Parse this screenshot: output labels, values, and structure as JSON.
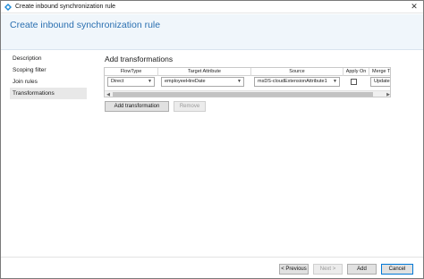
{
  "window": {
    "title": "Create inbound synchronization rule",
    "close_label": "✕"
  },
  "header": {
    "title": "Create inbound synchronization rule"
  },
  "nav": {
    "items": [
      {
        "label": "Description"
      },
      {
        "label": "Scoping filter"
      },
      {
        "label": "Join rules"
      },
      {
        "label": "Transformations"
      }
    ],
    "active": "Transformations"
  },
  "section": {
    "title": "Add transformations"
  },
  "grid": {
    "columns": [
      "FlowType",
      "Target Attribute",
      "Source",
      "Apply On",
      "Merge Type"
    ],
    "rows": [
      {
        "flow_type": "Direct",
        "target_attribute": "employeeHireDate",
        "source": "msDS-cloudExtensionAttribute1",
        "apply_once": false,
        "merge_type": "Update"
      }
    ]
  },
  "actions": {
    "add_transformation": "Add transformation",
    "remove": "Remove"
  },
  "footer": {
    "previous": "< Previous",
    "next": "Next >",
    "add": "Add",
    "cancel": "Cancel"
  },
  "colors": {
    "accent": "#2a6fb0",
    "header_bg": "#f0f6fb",
    "nav_active": "#e8e8e8",
    "primary_border": "#0078d7"
  }
}
